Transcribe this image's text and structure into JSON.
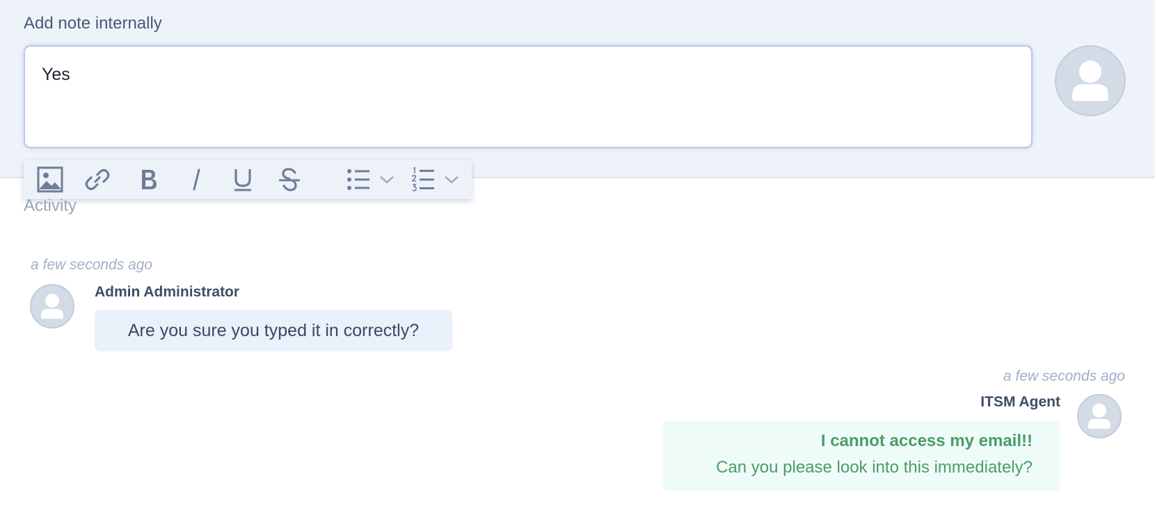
{
  "note": {
    "title": "Add note internally",
    "value": "Yes"
  },
  "toolbar": {
    "buttons": [
      {
        "icon": "image-icon"
      },
      {
        "icon": "link-icon"
      },
      {
        "icon": "bold-icon"
      },
      {
        "icon": "italic-icon"
      },
      {
        "icon": "underline-icon"
      },
      {
        "icon": "strikethrough-icon"
      },
      {
        "icon": "bullet-list-icon"
      },
      {
        "icon": "chevron-down-icon"
      },
      {
        "icon": "numbered-list-icon"
      },
      {
        "icon": "chevron-down-icon"
      }
    ]
  },
  "activity": {
    "title": "Activity",
    "entries": [
      {
        "timestamp": "a few seconds ago",
        "author": "Admin Administrator",
        "message": "Are you sure you typed it in correctly?"
      },
      {
        "timestamp": "a few seconds ago",
        "author": "ITSM Agent",
        "subject": "I cannot access my email!!",
        "message": "Can you please look into this immediately?"
      }
    ]
  },
  "colors": {
    "panel_bg": "#eef3f9",
    "icon": "#6f7d98",
    "agent_text": "#4a9d68",
    "admin_bubble": "#eaf1fb",
    "agent_bubble": "#effbf9"
  }
}
